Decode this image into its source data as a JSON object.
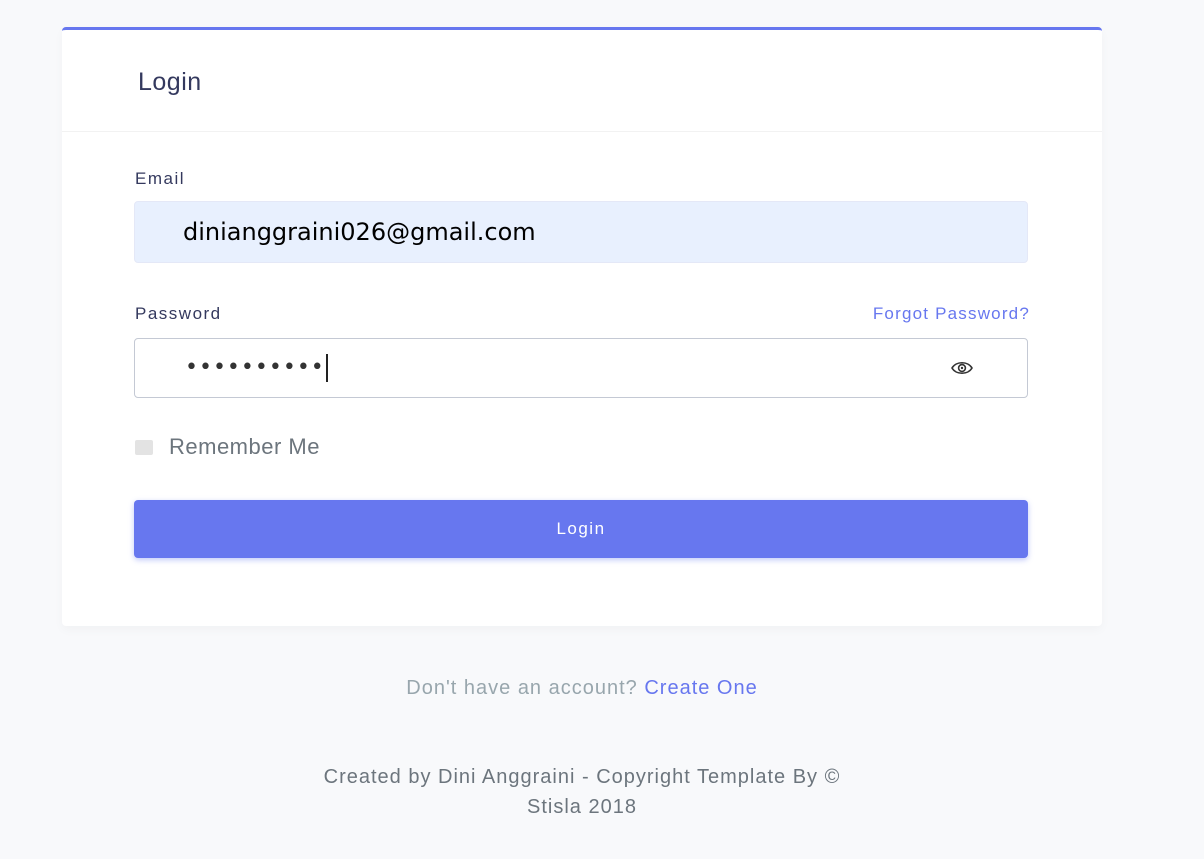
{
  "card": {
    "title": "Login"
  },
  "form": {
    "email_label": "Email",
    "email_value": "dinianggraini026@gmail.com",
    "password_label": "Password",
    "forgot_link": "Forgot Password?",
    "password_masked": "••••••••••",
    "toggle_icon": "eye-icon",
    "remember_label": "Remember Me",
    "remember_checked": false,
    "submit_label": "Login"
  },
  "signup": {
    "prompt": "Don't have an account? ",
    "link": "Create One"
  },
  "footer": {
    "line1": "Created by Dini Anggraini - Copyright Template By ©",
    "line2": "Stisla 2018"
  },
  "colors": {
    "accent": "#6777ef",
    "autofill_bg": "#e8f0fe",
    "page_bg": "#f8f9fb"
  }
}
